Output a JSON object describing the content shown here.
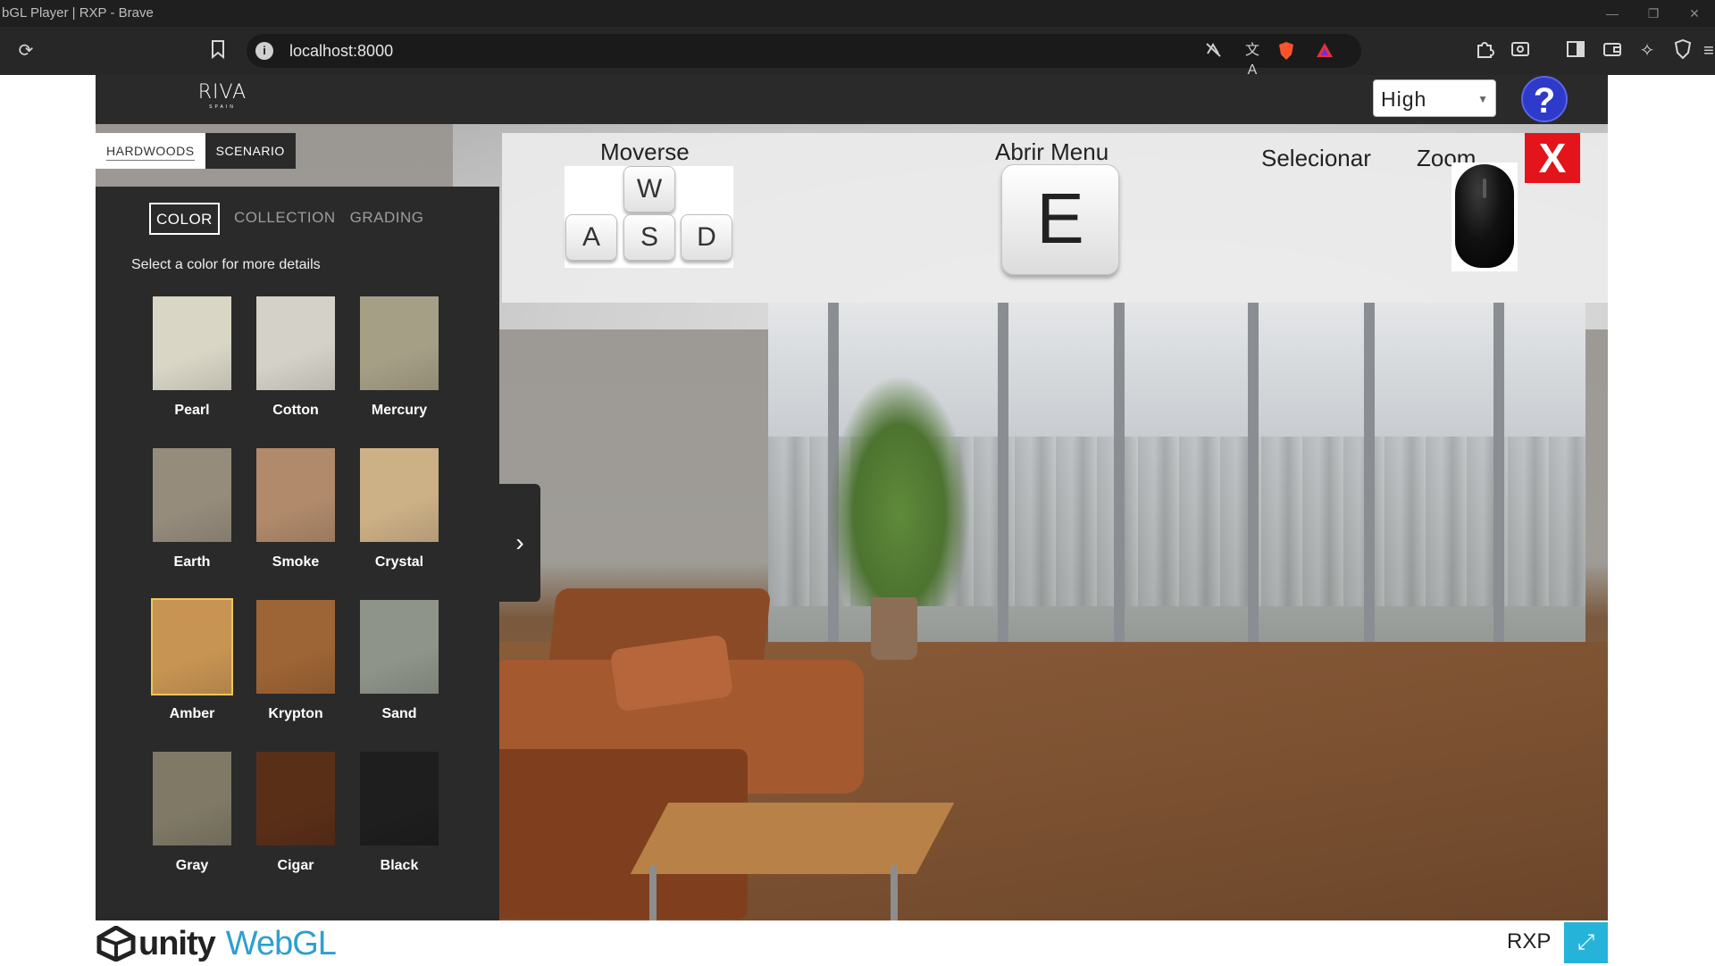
{
  "browser": {
    "window_title": "bGL Player | RXP - Brave",
    "url": "localhost:8000",
    "window_controls": {
      "minimize": "—",
      "restore": "❐",
      "close": "✕"
    },
    "icons": {
      "reload": "reload-icon",
      "bookmark": "bookmark-icon",
      "site_info": "info-icon",
      "read_aloud": "read-aloud-off-icon",
      "translate": "translate-icon",
      "brave_shield": "brave-shield-icon",
      "brave_rewards": "brave-rewards-icon",
      "extensions": "extensions-icon",
      "screenshot": "screenshot-icon",
      "sidebar": "sidebar-icon",
      "wallet": "wallet-icon",
      "leo": "leo-ai-icon",
      "vpn": "vpn-shield-icon",
      "menu": "menu-icon"
    }
  },
  "app": {
    "logo_text": "RIVA",
    "logo_subtext": "SPAIN",
    "quality": {
      "selected": "High"
    },
    "help_label": "?",
    "panel_tabs": [
      {
        "label": "HARDWOODS",
        "active": true
      },
      {
        "label": "SCENARIO",
        "active": false
      }
    ],
    "sub_tabs": [
      {
        "label": "COLOR",
        "active": true
      },
      {
        "label": "COLLECTION",
        "active": false
      },
      {
        "label": "GRADING",
        "active": false
      }
    ],
    "panel_hint": "Select a color for more details",
    "swatches": [
      {
        "label": "Pearl",
        "color": "#d9d6c6",
        "selected": false
      },
      {
        "label": "Cotton",
        "color": "#d4d1c8",
        "selected": false
      },
      {
        "label": "Mercury",
        "color": "#a59f86",
        "selected": false
      },
      {
        "label": "Earth",
        "color": "#958c7c",
        "selected": false
      },
      {
        "label": "Smoke",
        "color": "#b08a6b",
        "selected": false
      },
      {
        "label": "Crystal",
        "color": "#ccb086",
        "selected": false
      },
      {
        "label": "Amber",
        "color": "#c89453",
        "selected": true
      },
      {
        "label": "Krypton",
        "color": "#9d6435",
        "selected": false
      },
      {
        "label": "Sand",
        "color": "#8f948a",
        "selected": false
      },
      {
        "label": "Gray",
        "color": "#7f7966",
        "selected": false
      },
      {
        "label": "Cigar",
        "color": "#5a2f18",
        "selected": false
      },
      {
        "label": "Black",
        "color": "#1e1e1e",
        "selected": false
      }
    ],
    "panel_toggle": "›",
    "controls": {
      "move_label": "Moverse",
      "move_keys": [
        "W",
        "A",
        "S",
        "D"
      ],
      "menu_label": "Abrir Menu",
      "menu_key": "E",
      "select_label": "Selecionar",
      "zoom_label": "Zoom",
      "close_label": "X"
    },
    "footer": {
      "unity_text": "unity",
      "webgl_text": "WebGL",
      "product_text": "RXP",
      "fullscreen_icon": "⤢"
    },
    "colors": {
      "panel_bg": "#2a2a2a",
      "help_button": "#2d3aca",
      "close_button": "#e4141b",
      "selected_outline": "#f0c65a",
      "webgl_blue": "#2e9fd0",
      "fullscreen_bg": "#25b3d9"
    }
  }
}
